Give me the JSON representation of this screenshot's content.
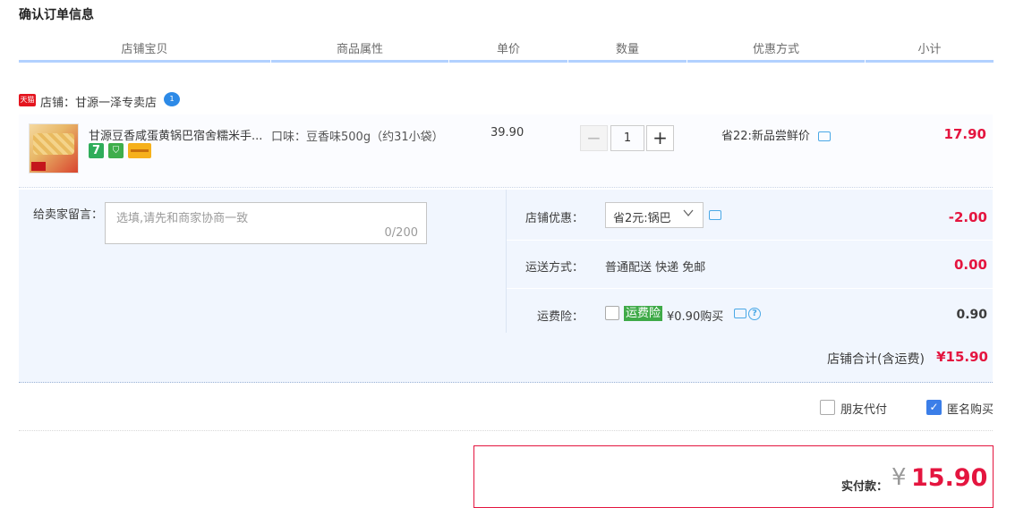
{
  "page_title": "确认订单信息",
  "columns": [
    "店铺宝贝",
    "商品属性",
    "单价",
    "数量",
    "优惠方式",
    "小计"
  ],
  "shop": {
    "badge": "天猫",
    "name": "店铺：甘源一泽专卖店",
    "chat_badge": "1"
  },
  "item": {
    "title": "甘源豆香咸蛋黄锅巴宿舍糯米手...",
    "icon_seven": "7",
    "icon_shield": "⛉",
    "attribute": "口味：豆香味500g（约31小袋）",
    "unit_price": "39.90",
    "quantity": "1",
    "minus": "−",
    "plus": "+",
    "promotion": "省22:新品尝鲜价",
    "subtotal": "17.90"
  },
  "message": {
    "label": "给卖家留言：",
    "placeholder": "选填,请先和商家协商一致",
    "counter": "0/200"
  },
  "shop_discount": {
    "label": "店铺优惠：",
    "selected": "省2元:锅巴",
    "amount": "-2.00"
  },
  "shipping": {
    "label": "运送方式：",
    "value": "普通配送 快递 免邮",
    "amount": "0.00"
  },
  "insurance": {
    "label": "运费险：",
    "badge": "运费险",
    "text": "¥0.90购买",
    "help": "?",
    "amount": "0.90"
  },
  "shop_total": {
    "label": "店铺合计(含运费)",
    "amount": "¥15.90"
  },
  "options": {
    "friend_pay": "朋友代付",
    "anonymous": "匿名购买",
    "anonymous_checked": "✓"
  },
  "payment": {
    "label": "实付款：",
    "currency": "¥",
    "amount": "15.90"
  },
  "colors": {
    "accent_red": "#e4153f",
    "header_blue": "#b2d1ff",
    "panel_bg": "#f1f6fe",
    "green_badge": "#3faa48"
  }
}
